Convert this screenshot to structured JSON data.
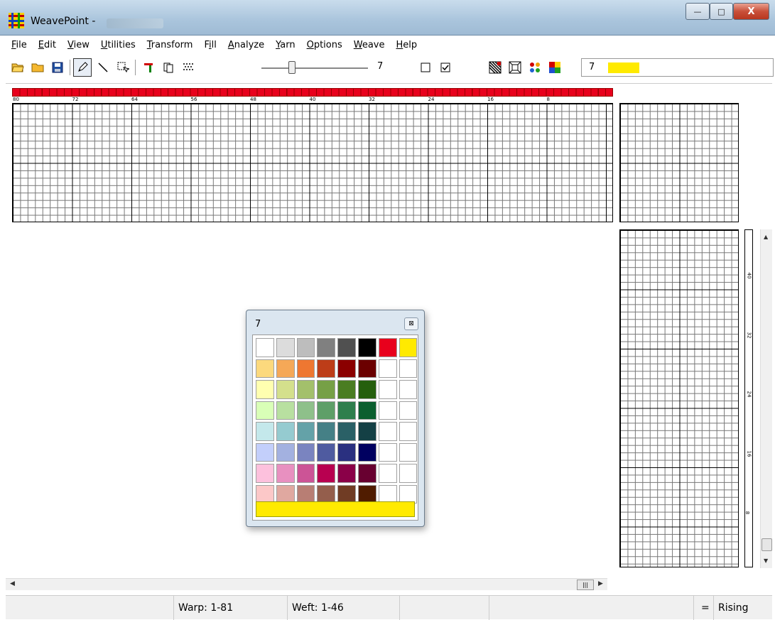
{
  "window": {
    "title": "WeavePoint -",
    "controls": {
      "minimize": "—",
      "maximize": "□",
      "close": "X"
    }
  },
  "menubar": [
    {
      "pre": "",
      "ul": "F",
      "post": "ile"
    },
    {
      "pre": "",
      "ul": "E",
      "post": "dit"
    },
    {
      "pre": "",
      "ul": "V",
      "post": "iew"
    },
    {
      "pre": "",
      "ul": "U",
      "post": "tilities"
    },
    {
      "pre": "",
      "ul": "T",
      "post": "ransform"
    },
    {
      "pre": "F",
      "ul": "i",
      "post": "ll"
    },
    {
      "pre": "",
      "ul": "A",
      "post": "nalyze"
    },
    {
      "pre": "",
      "ul": "Y",
      "post": "arn"
    },
    {
      "pre": "",
      "ul": "O",
      "post": "ptions"
    },
    {
      "pre": "",
      "ul": "W",
      "post": "eave"
    },
    {
      "pre": "",
      "ul": "H",
      "post": "elp"
    }
  ],
  "toolbar": {
    "icons": [
      "open-folder-icon",
      "folder-icon",
      "save-icon",
      "pencil-icon",
      "line-icon",
      "select-icon",
      "thread-color-icon",
      "copy-icon",
      "pattern-icon",
      "checkbox-empty-icon",
      "checkbox-checked-icon",
      "weave-view-icon",
      "color-view-icon",
      "colors-icon",
      "palette-icon"
    ],
    "slider_value": "7",
    "current_color_number": "7",
    "current_color": "#ffea00"
  },
  "ruler": {
    "labels": [
      "80",
      "72",
      "64",
      "56",
      "48",
      "40",
      "32",
      "24",
      "16",
      "8"
    ],
    "color": "#e8001c"
  },
  "weft_labels": [
    "40",
    "32",
    "24",
    "16",
    "8"
  ],
  "palette": {
    "title": "7",
    "close": "⊠",
    "colors": [
      "#ffffff",
      "#dcdcdc",
      "#bdbdbd",
      "#808080",
      "#505050",
      "#000000",
      "#e8001c",
      "#ffea00",
      "#fcd97d",
      "#f5a857",
      "#ee7731",
      "#bd3d18",
      "#8b0000",
      "#6b0000",
      "#ffffff",
      "#ffffff",
      "#ffffb0",
      "#d4e08c",
      "#a3c06b",
      "#76a046",
      "#4a7d22",
      "#255f0d",
      "#ffffff",
      "#ffffff",
      "#d9ffb7",
      "#b8e0a0",
      "#8ec08a",
      "#5e9f68",
      "#2f7f4d",
      "#0b5f2f",
      "#ffffff",
      "#ffffff",
      "#c4e8eb",
      "#95cbd0",
      "#64a2a8",
      "#458086",
      "#2a6066",
      "#144045",
      "#ffffff",
      "#ffffff",
      "#c3cffb",
      "#a3b1e0",
      "#7a84c0",
      "#4f5ba0",
      "#2a3080",
      "#000060",
      "#ffffff",
      "#ffffff",
      "#fdc1dd",
      "#e890c0",
      "#cc5496",
      "#b80050",
      "#8a0048",
      "#680030",
      "#ffffff",
      "#ffffff",
      "#fcc8c8",
      "#e0a8a0",
      "#b87e74",
      "#945e4c",
      "#703c24",
      "#501c00",
      "#ffffff",
      "#ffffff"
    ],
    "current_color": "#ffea00"
  },
  "status": {
    "warp": "Warp: 1-81",
    "weft": "Weft: 1-46",
    "mode_prefix": "=",
    "mode": "Rising"
  }
}
